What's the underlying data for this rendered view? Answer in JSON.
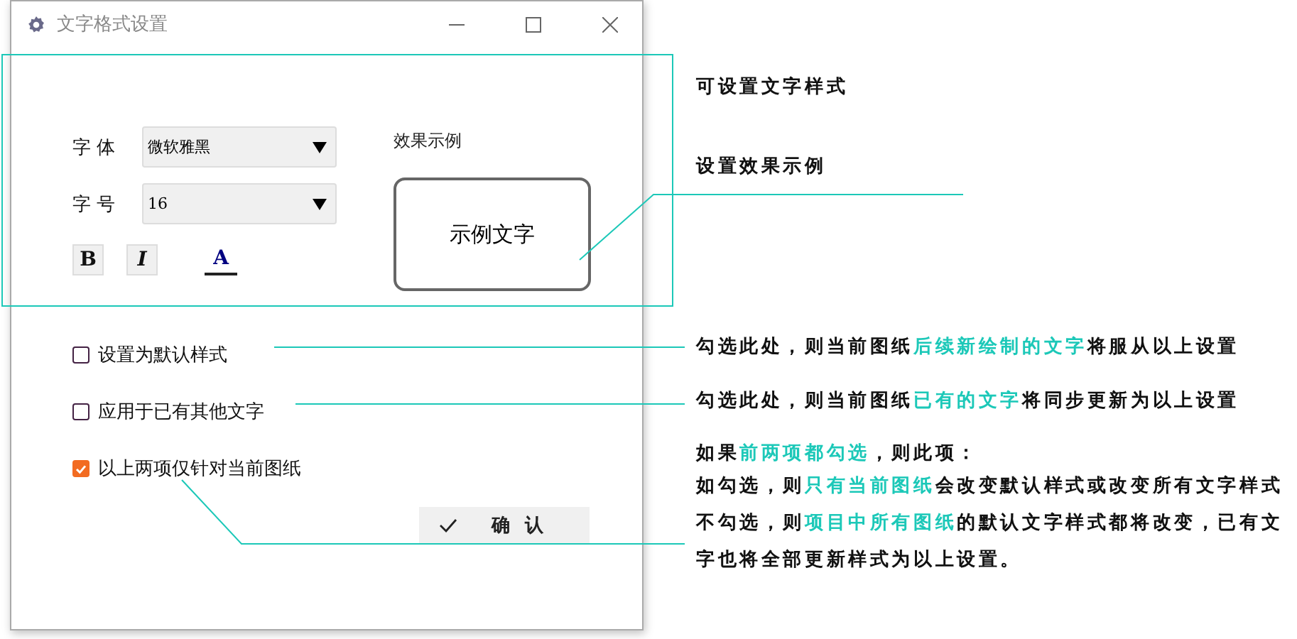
{
  "window": {
    "title": "文字格式设置"
  },
  "form": {
    "font_label": "字 体",
    "font_value": "微软雅黑",
    "size_label": "字 号",
    "size_value": "16",
    "bold": "B",
    "italic": "I",
    "font_color_letter": "A"
  },
  "preview": {
    "label": "效果示例",
    "sample": "示例文字"
  },
  "options": [
    {
      "label": "设置为默认样式",
      "checked": false
    },
    {
      "label": "应用于已有其他文字",
      "checked": false
    },
    {
      "label": "以上两项仅针对当前图纸",
      "checked": true
    }
  ],
  "confirm": "确 认",
  "annotations": [
    {
      "segments": [
        {
          "text": "可设置文字样式",
          "highlight": false
        }
      ]
    },
    {
      "segments": [
        {
          "text": "设置效果示例",
          "highlight": false
        }
      ]
    },
    {
      "segments": [
        {
          "text": "勾选此处，则当前图纸",
          "highlight": false
        },
        {
          "text": "后续新绘制的文字",
          "highlight": true
        },
        {
          "text": "将服从以上设置",
          "highlight": false
        }
      ]
    },
    {
      "segments": [
        {
          "text": "勾选此处，则当前图纸",
          "highlight": false
        },
        {
          "text": "已有的文字",
          "highlight": true
        },
        {
          "text": "将同步更新为以上设置",
          "highlight": false
        }
      ]
    },
    {
      "segments": [
        {
          "text": "如果",
          "highlight": false
        },
        {
          "text": "前两项都勾选",
          "highlight": true
        },
        {
          "text": "，则此项：",
          "highlight": false
        }
      ]
    },
    {
      "segments": [
        {
          "text": "如勾选，则",
          "highlight": false
        },
        {
          "text": "只有当前图纸",
          "highlight": true
        },
        {
          "text": "会改变默认样式或改变所有文字样式",
          "highlight": false
        }
      ]
    },
    {
      "segments": [
        {
          "text": "不勾选，则",
          "highlight": false
        },
        {
          "text": "项目中所有图纸",
          "highlight": true
        },
        {
          "text": "的默认文字样式都将改变，已有文字也将全部更新样式为以上设置。",
          "highlight": false
        }
      ]
    }
  ]
}
